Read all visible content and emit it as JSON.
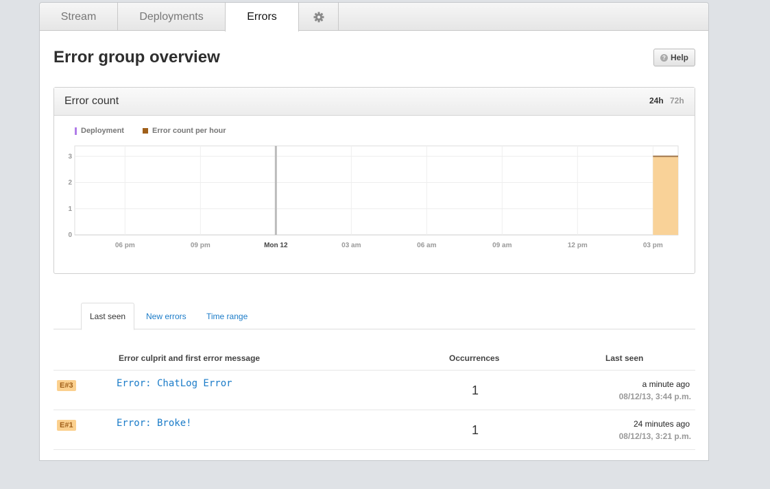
{
  "tabs": [
    {
      "label": "Stream"
    },
    {
      "label": "Deployments"
    },
    {
      "label": "Errors"
    }
  ],
  "settings_icon": "gear-icon",
  "title": "Error group overview",
  "help_label": "Help",
  "card": {
    "title": "Error count",
    "range_24": "24h",
    "range_72": "72h"
  },
  "legend": {
    "deployment": "Deployment",
    "errors": "Error count per hour"
  },
  "colors": {
    "deployment": "#b07ce8",
    "bar": "#f9d298",
    "bar_top": "#a0764a",
    "link": "#1a7bc8",
    "badge": "#fbd08e"
  },
  "chart_data": {
    "type": "bar",
    "title": "Error count",
    "x_unit": "hours since Sun 4 pm",
    "xlim": [
      0,
      24
    ],
    "ylim": [
      0,
      3.4
    ],
    "yticks": [
      0,
      1,
      2,
      3
    ],
    "xticks": [
      {
        "hour": 2,
        "label": "06 pm"
      },
      {
        "hour": 5,
        "label": "09 pm"
      },
      {
        "hour": 8,
        "label": "Mon 12",
        "bold": true
      },
      {
        "hour": 11,
        "label": "03 am"
      },
      {
        "hour": 14,
        "label": "06 am"
      },
      {
        "hour": 17,
        "label": "09 am"
      },
      {
        "hour": 20,
        "label": "12 pm"
      },
      {
        "hour": 23,
        "label": "03 pm"
      }
    ],
    "bars": [
      {
        "start": 23,
        "end": 24,
        "value": 3
      }
    ],
    "deployments": [
      8
    ],
    "grid": true,
    "legend_position": "top-left"
  },
  "subtabs": [
    {
      "label": "Last seen"
    },
    {
      "label": "New errors"
    },
    {
      "label": "Time range"
    }
  ],
  "columns": {
    "culprit": "Error culprit and first error message",
    "occurrences": "Occurrences",
    "last_seen": "Last seen"
  },
  "rows": [
    {
      "badge": "E#3",
      "message": "Error: ChatLog Error",
      "occurrences": "1",
      "ago": "a minute ago",
      "date": "08/12/13, 3:44 p.m."
    },
    {
      "badge": "E#1",
      "message": "Error: Broke!",
      "occurrences": "1",
      "ago": "24 minutes ago",
      "date": "08/12/13, 3:21 p.m."
    }
  ]
}
